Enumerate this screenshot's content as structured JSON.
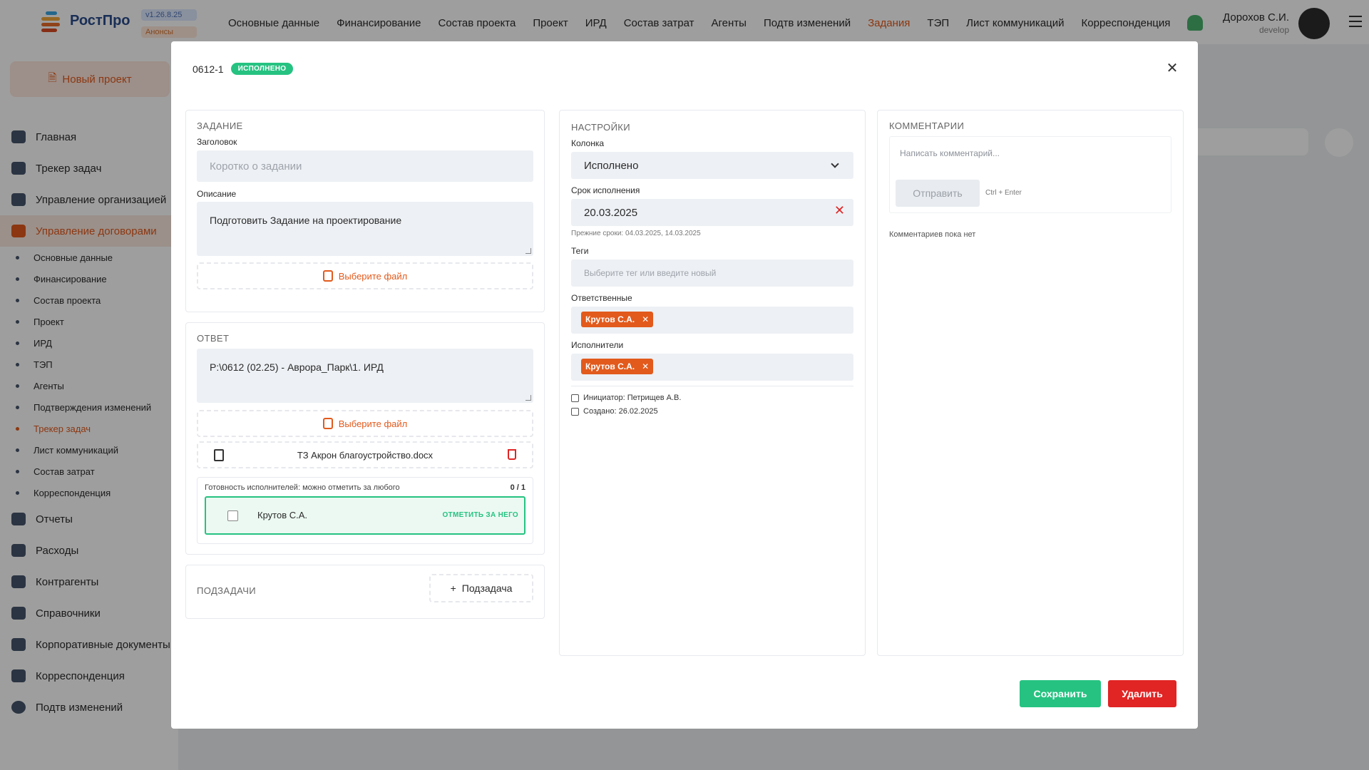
{
  "app": {
    "logo_text": "РостПро",
    "version": "v1.26.8.25",
    "announcements": "Анонсы",
    "nav": [
      "Основные данные",
      "Финансирование",
      "Состав проекта",
      "Проект",
      "ИРД",
      "Состав затрат",
      "Агенты",
      "Подтв изменений",
      "Задания",
      "ТЭП",
      "Лист коммуникаций",
      "Корреспонденция"
    ],
    "nav_active_index": 8,
    "user_name": "Дорохов С.И.",
    "user_role": "develop",
    "accent_color": "#e25a1c"
  },
  "sidebar": {
    "new_project": "Новый проект",
    "main_items": [
      {
        "label": "Главная"
      },
      {
        "label": "Трекер задач"
      },
      {
        "label": "Управление организацией"
      },
      {
        "label": "Управление договорами"
      }
    ],
    "sub_items": [
      "Основные данные",
      "Финансирование",
      "Состав проекта",
      "Проект",
      "ИРД",
      "ТЭП",
      "Агенты",
      "Подтверждения изменений",
      "Трекер задач",
      "Лист коммуникаций",
      "Состав затрат",
      "Корреспонденция"
    ],
    "bottom_items": [
      {
        "label": "Отчеты"
      },
      {
        "label": "Расходы"
      },
      {
        "label": "Контрагенты"
      },
      {
        "label": "Справочники"
      },
      {
        "label": "Корпоративные документы"
      },
      {
        "label": "Корреспонденция"
      },
      {
        "label": "Подтв изменений"
      }
    ]
  },
  "modal": {
    "task_id": "0612-1",
    "status_badge": "ИСПОЛНЕНО",
    "status_color": "#26c281",
    "task_section": {
      "title": "ЗАДАНИЕ",
      "title_label": "Заголовок",
      "title_placeholder": "Коротко о задании",
      "description_label": "Описание",
      "description_value": "Подготовить Задание на проектирование",
      "file_button": "Выберите файл"
    },
    "answer_section": {
      "title": "ОТВЕТ",
      "answer_value": "P:\\0612 (02.25) - Аврора_Парк\\1. ИРД",
      "file_button": "Выберите файл",
      "attached_file": "ТЗ Акрон благоустройство.docx",
      "readiness_label": "Готовность исполнителей: можно отметить за любого",
      "readiness_count": "0 / 1",
      "executor_name": "Крутов С.А.",
      "mark_button": "ОТМЕТИТЬ ЗА НЕГО"
    },
    "subtasks_section": {
      "title": "ПОДЗАДАЧИ",
      "add_button": "Подзадача"
    },
    "settings_section": {
      "title": "НАСТРОЙКИ",
      "column_label": "Колонка",
      "column_value": "Исполнено",
      "deadline_label": "Срок исполнения",
      "deadline_value": "20.03.2025",
      "previous_deadlines": "Прежние сроки: 04.03.2025, 14.03.2025",
      "tags_label": "Теги",
      "tags_placeholder": "Выберите тег или введите новый",
      "responsible_label": "Ответственные",
      "responsible_tag": "Крутов С.А.",
      "executors_label": "Исполнители",
      "executors_tag": "Крутов С.А.",
      "initiator": "Инициатор: Петрищев А.В.",
      "created": "Создано: 26.02.2025"
    },
    "comments_section": {
      "title": "КОММЕНТАРИИ",
      "comment_placeholder": "Написать комментарий...",
      "send_button": "Отправить",
      "shortcut_hint": "Ctrl + Enter",
      "empty_text": "Комментариев пока нет"
    },
    "save_button": "Сохранить",
    "delete_button": "Удалить",
    "save_color": "#26c281",
    "delete_color": "#e12424"
  }
}
